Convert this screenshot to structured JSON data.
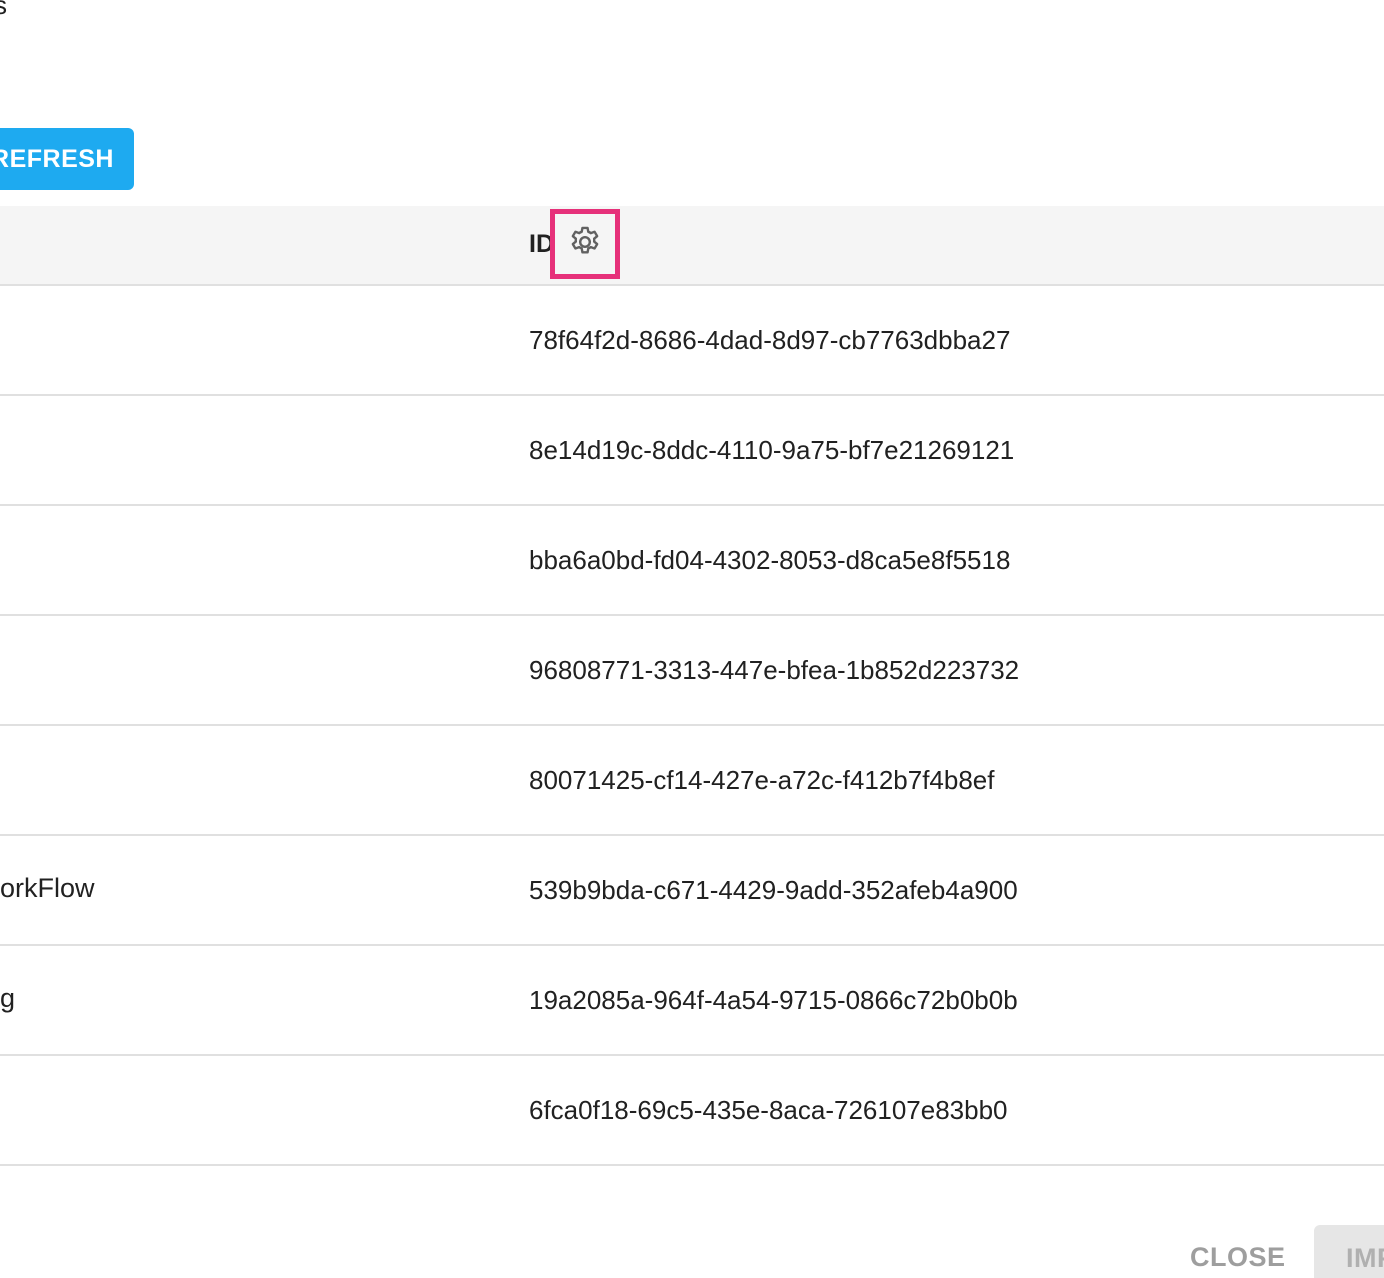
{
  "header_fragment": "s",
  "toolbar": {
    "refresh_label": "REFRESH"
  },
  "table": {
    "columns": {
      "id_label": "ID",
      "settings_icon": "gear-icon"
    },
    "rows": [
      {
        "name": "",
        "id": "78f64f2d-8686-4dad-8d97-cb7763dbba27"
      },
      {
        "name": "",
        "id": "8e14d19c-8ddc-4110-9a75-bf7e21269121"
      },
      {
        "name": "",
        "id": "bba6a0bd-fd04-4302-8053-d8ca5e8f5518"
      },
      {
        "name": "",
        "id": "96808771-3313-447e-bfea-1b852d223732"
      },
      {
        "name": "",
        "id": "80071425-cf14-427e-a72c-f412b7f4b8ef"
      },
      {
        "name": "orkFlow",
        "id": "539b9bda-c671-4429-9add-352afeb4a900"
      },
      {
        "name": "g",
        "id": "19a2085a-964f-4a54-9715-0866c72b0b0b"
      },
      {
        "name": "",
        "id": "6fca0f18-69c5-435e-8aca-726107e83bb0"
      }
    ]
  },
  "footer": {
    "close_label": "CLOSE",
    "import_label": "IMPORT"
  },
  "colors": {
    "accent": "#1eaaf0",
    "highlight": "#e6317a",
    "header_bg": "#f5f5f5",
    "divider": "#e0e0e0"
  }
}
